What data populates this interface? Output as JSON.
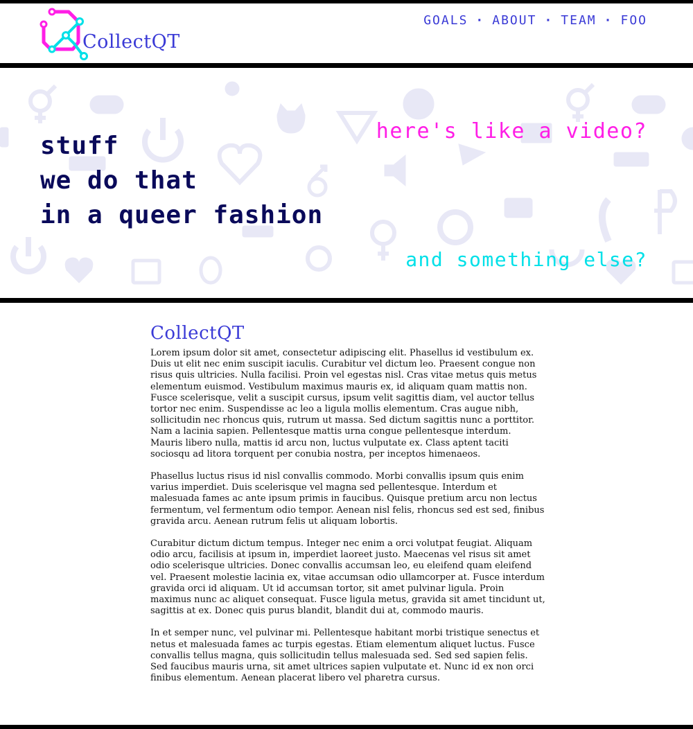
{
  "brand": {
    "name": "CollectQT",
    "colors": {
      "magenta": "#ff1ee6",
      "cyan": "#00e0e8",
      "blue": "#3a3ad6",
      "navy": "#0a0a5a"
    }
  },
  "nav": {
    "items": [
      "GOALS",
      "ABOUT",
      "TEAM",
      "FOO"
    ],
    "separator": "·"
  },
  "hero": {
    "lines": [
      "stuff",
      "we do that",
      "in a queer fashion"
    ],
    "video_text": "here's like a video?",
    "else_text": "and something else?",
    "background_icons": [
      "gender-symbol-icon",
      "gamepad-icon",
      "power-icon",
      "cat-icon",
      "triangle-icon",
      "gear-icon",
      "heart-icon",
      "speaker-icon",
      "keyboard-icon",
      "camera-icon",
      "bug-icon",
      "image-icon",
      "wheelchair-icon",
      "venus-icon",
      "play-icon",
      "phone-icon"
    ]
  },
  "article": {
    "title": "CollectQT",
    "paragraphs": [
      "Lorem ipsum dolor sit amet, consectetur adipiscing elit. Phasellus id vestibulum ex. Duis ut elit nec enim suscipit iaculis. Curabitur vel dictum leo. Praesent congue non risus quis ultricies. Nulla facilisi. Proin vel egestas nisl. Cras vitae metus quis metus elementum euismod. Vestibulum maximus mauris ex, id aliquam quam mattis non. Fusce scelerisque, velit a suscipit cursus, ipsum velit sagittis diam, vel auctor tellus tortor nec enim. Suspendisse ac leo a ligula mollis elementum. Cras augue nibh, sollicitudin nec rhoncus quis, rutrum ut massa. Sed dictum sagittis nunc a porttitor. Nam a lacinia sapien. Pellentesque mattis urna congue pellentesque interdum. Mauris libero nulla, mattis id arcu non, luctus vulputate ex. Class aptent taciti sociosqu ad litora torquent per conubia nostra, per inceptos himenaeos.",
      "Phasellus luctus risus id nisl convallis commodo. Morbi convallis ipsum quis enim varius imperdiet. Duis scelerisque vel magna sed pellentesque. Interdum et malesuada fames ac ante ipsum primis in faucibus. Quisque pretium arcu non lectus fermentum, vel fermentum odio tempor. Aenean nisl felis, rhoncus sed est sed, finibus gravida arcu. Aenean rutrum felis ut aliquam lobortis.",
      "Curabitur dictum dictum tempus. Integer nec enim a orci volutpat feugiat. Aliquam odio arcu, facilisis at ipsum in, imperdiet laoreet justo. Maecenas vel risus sit amet odio scelerisque ultricies. Donec convallis accumsan leo, eu eleifend quam eleifend vel. Praesent molestie lacinia ex, vitae accumsan odio ullamcorper at. Fusce interdum gravida orci id aliquam. Ut id accumsan tortor, sit amet pulvinar ligula. Proin maximus nunc ac aliquet consequat. Fusce ligula metus, gravida sit amet tincidunt ut, sagittis at ex. Donec quis purus blandit, blandit dui at, commodo mauris.",
      "In et semper nunc, vel pulvinar mi. Pellentesque habitant morbi tristique senectus et netus et malesuada fames ac turpis egestas. Etiam elementum aliquet luctus. Fusce convallis tellus magna, quis sollicitudin tellus malesuada sed. Sed sed sapien felis. Sed faucibus mauris urna, sit amet ultrices sapien vulputate et. Nunc id ex non orci finibus elementum. Aenean placerat libero vel pharetra cursus."
    ]
  }
}
